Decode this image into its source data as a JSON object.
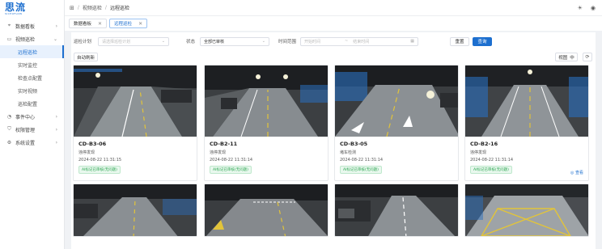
{
  "app": {
    "logo_main": "思流",
    "logo_sub": "SICHUFLOW"
  },
  "sidebar": {
    "items": [
      {
        "label": "数据看板",
        "icon": "location-icon",
        "caret": "›"
      },
      {
        "label": "视频巡检",
        "icon": "monitor-icon",
        "caret": "⌄"
      },
      {
        "label": "远程巡检"
      },
      {
        "label": "实时监控"
      },
      {
        "label": "检查点配置"
      },
      {
        "label": "实时视频"
      },
      {
        "label": "巡检配置"
      },
      {
        "label": "事件中心",
        "icon": "bell-icon",
        "caret": "›"
      },
      {
        "label": "权限管理",
        "icon": "shield-icon",
        "caret": "›"
      },
      {
        "label": "系统设置",
        "icon": "gear-icon",
        "caret": "›"
      }
    ]
  },
  "topbar": {
    "home_icon": "grid-icon",
    "bc1": "视频巡检",
    "bc2": "远程巡检",
    "sep": "/",
    "icon_a": "sun-icon",
    "icon_b": "user-icon"
  },
  "tabs": [
    {
      "label": "数据看板",
      "close": "✕"
    },
    {
      "label": "远程巡检",
      "close": "✕"
    }
  ],
  "filters": {
    "plan_label": "巡检计划",
    "plan_placeholder": "请选择巡检计划",
    "status_label": "状态",
    "status_value": "全部已审核",
    "time_label": "时间范围",
    "start_placeholder": "开始时间",
    "range_sep": "~",
    "end_placeholder": "结束时间",
    "reset": "重置",
    "query": "查询"
  },
  "toolbar": {
    "auto_refresh": "自动刷新",
    "view_label": "视图",
    "view_value": "中",
    "refresh_icon": "⟳"
  },
  "cards": [
    {
      "camera": "CD-B3-06",
      "type": "违停发现",
      "time": "2024-08-22 11:31:15",
      "badge": "AI标记已审核(无问题)"
    },
    {
      "camera": "CD-B2-11",
      "type": "违停发现",
      "time": "2024-08-22 11:31:14",
      "badge": "AI标记已审核(无问题)"
    },
    {
      "camera": "CD-B3-05",
      "type": "堵车检测",
      "time": "2024-08-22 11:31:14",
      "badge": "AI标记已审核(无问题)"
    },
    {
      "camera": "CD-B2-16",
      "type": "违停发现",
      "time": "2024-08-22 11:31:14",
      "badge": "AI标记已审核(无问题)",
      "view": "◎ 查看"
    }
  ],
  "colors": {
    "accent": "#1d6fcf",
    "success": "#2aa44f",
    "lane_yellow": "#e2c43a"
  }
}
